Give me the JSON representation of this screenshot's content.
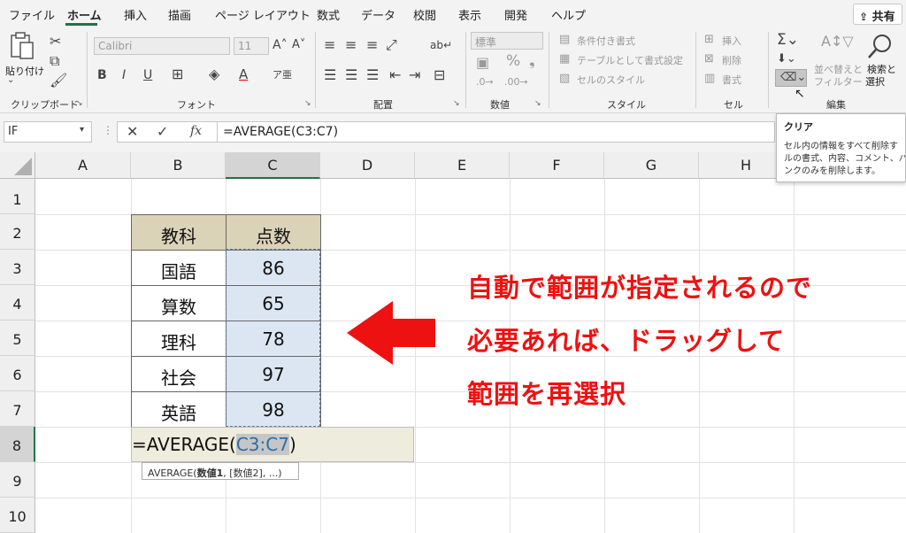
{
  "tabs": [
    "ファイル",
    "ホーム",
    "挿入",
    "描画",
    "ページ レイアウト",
    "数式",
    "データ",
    "校閲",
    "表示",
    "開発",
    "ヘルプ"
  ],
  "share_label": "共有",
  "ribbon": {
    "clipboard": {
      "paste": "貼り付け",
      "group": "クリップボード"
    },
    "font": {
      "name": "Calibri",
      "size": "11",
      "group": "フォント"
    },
    "alignment": {
      "group": "配置"
    },
    "number": {
      "format": "標準",
      "group": "数値"
    },
    "styles": {
      "cond": "条件付き書式",
      "table": "テーブルとして書式設定",
      "cell": "セルのスタイル",
      "group": "スタイル"
    },
    "cells": {
      "insert": "挿入",
      "delete": "削除",
      "format": "書式",
      "group": "セル"
    },
    "editing": {
      "sort_line1": "並べ替えと",
      "sort_line2": "フィルター",
      "find_line1": "検索と",
      "find_line2": "選択",
      "group": "編集"
    }
  },
  "namebox": "IF",
  "formula": "=AVERAGE(C3:C7)",
  "columns": [
    "A",
    "B",
    "C",
    "D",
    "E",
    "F",
    "G",
    "H"
  ],
  "rows": [
    "1",
    "2",
    "3",
    "4",
    "5",
    "6",
    "7",
    "8",
    "9",
    "10"
  ],
  "table": {
    "headers": [
      "教科",
      "点数"
    ],
    "rows": [
      {
        "subject": "国語",
        "score": "86"
      },
      {
        "subject": "算数",
        "score": "65"
      },
      {
        "subject": "理科",
        "score": "78"
      },
      {
        "subject": "社会",
        "score": "97"
      },
      {
        "subject": "英語",
        "score": "98"
      }
    ]
  },
  "edit": {
    "prefix": "=AVERAGE(",
    "ref": "C3:C7",
    "suffix": ")"
  },
  "fn_tooltip": {
    "prefix": "AVERAGE(",
    "bold": "数値1",
    "rest": ", [数値2], ...)"
  },
  "clear_tooltip": {
    "title": "クリア",
    "lines": [
      "セル内の情報をすべて削除す",
      "ルの書式、内容、コメント、ハ",
      "ンクのみを削除します。"
    ]
  },
  "annotation": [
    "自動で範囲が指定されるので",
    "必要あれば、ドラッグして",
    "範囲を再選択"
  ],
  "colors": {
    "accent": "#217346",
    "note": "#ee1111",
    "header_fill": "#dbd3b8",
    "selection_fill": "#dce6f3"
  }
}
